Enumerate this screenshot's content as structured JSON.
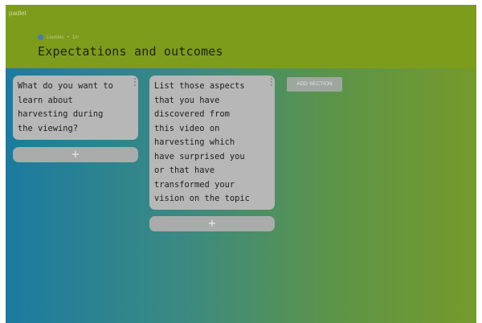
{
  "app": {
    "brand": "padlet"
  },
  "header": {
    "author": "Lourdes",
    "separator": "•",
    "time": "1m",
    "title": "Expectations and outcomes",
    "background_color": "#7e9c1c"
  },
  "columns": [
    {
      "card_text": "What do you want to\nlearn about\nharvesting during\nthe viewing?",
      "add_label": "+"
    },
    {
      "card_text": "List those aspects\nthat you have\ndiscovered from\nthis video on\nharvesting which\nhave surprised you\nor that have\ntransformed your\nvision on the topic",
      "add_label": "+"
    }
  ],
  "add_section": {
    "label": "ADD SECTION"
  },
  "icons": {
    "avatar": "avatar-icon",
    "card_menu": "more-vertical-icon"
  }
}
